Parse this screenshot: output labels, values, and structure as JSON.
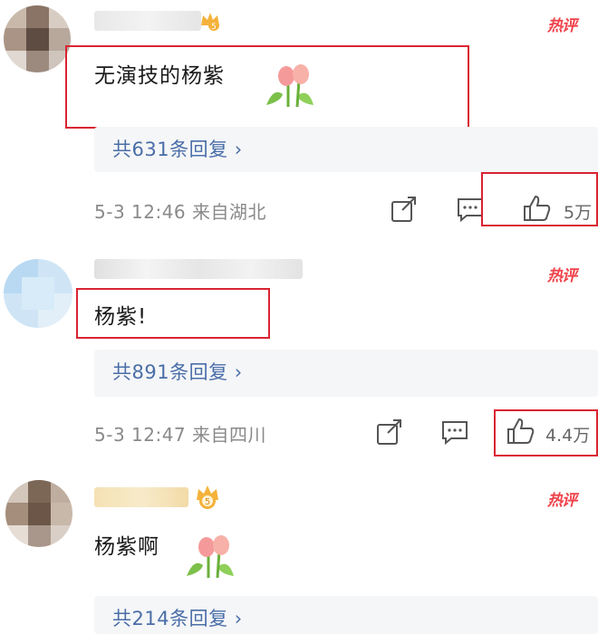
{
  "comments": [
    {
      "content": "无演技的杨紫",
      "hot_label": "热评",
      "replies_label": "共631条回复 ›",
      "meta": "5-3 12:46 来自湖北",
      "like_count": "5万",
      "level_badge": "5"
    },
    {
      "content": "杨紫!",
      "hot_label": "热评",
      "replies_label": "共891条回复 ›",
      "meta": "5-3 12:47 来自四川",
      "like_count": "4.4万"
    },
    {
      "content": "杨紫啊",
      "hot_label": "热评",
      "replies_label": "共214条回复 ›",
      "level_badge": "5"
    }
  ],
  "icons": {
    "share": "share-icon",
    "comment": "comment-icon",
    "like": "thumbs-up-icon",
    "emoji": "tulip-emoji"
  },
  "colors": {
    "highlight_box": "#d92432",
    "hot_label": "#f0424a",
    "reply_link": "#4a6ea8",
    "meta_text": "#8a8a8a"
  }
}
